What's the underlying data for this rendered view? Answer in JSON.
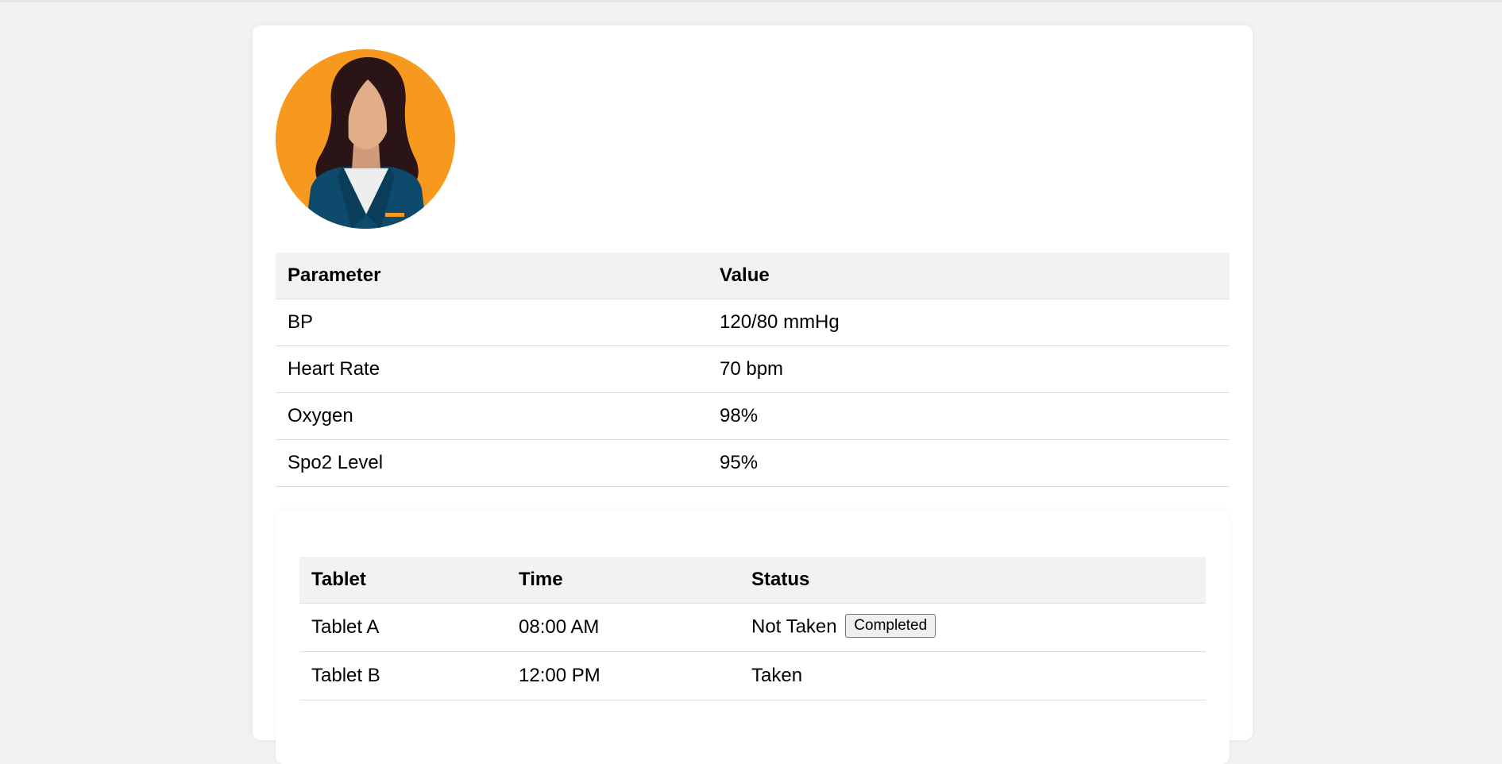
{
  "vitals": {
    "headers": [
      "Parameter",
      "Value"
    ],
    "rows": [
      {
        "parameter": "BP",
        "value": "120/80 mmHg"
      },
      {
        "parameter": "Heart Rate",
        "value": "70 bpm"
      },
      {
        "parameter": "Oxygen",
        "value": "98%"
      },
      {
        "parameter": "Spo2 Level",
        "value": "95%"
      }
    ]
  },
  "medications": {
    "headers": [
      "Tablet",
      "Time",
      "Status"
    ],
    "rows": [
      {
        "tablet": "Tablet A",
        "time": "08:00 AM",
        "status": "Not Taken",
        "action_label": "Completed"
      },
      {
        "tablet": "Tablet B",
        "time": "12:00 PM",
        "status": "Taken"
      }
    ]
  },
  "colors": {
    "page_background": "#f2f2f2",
    "card_background": "#ffffff",
    "header_row_background": "#f2f2f2",
    "avatar_background": "#f7981f",
    "avatar_jacket": "#0d4a6b",
    "avatar_hair": "#2a1416",
    "avatar_skin": "#e2ae87"
  },
  "icons": {
    "avatar": "female-profile-avatar"
  }
}
